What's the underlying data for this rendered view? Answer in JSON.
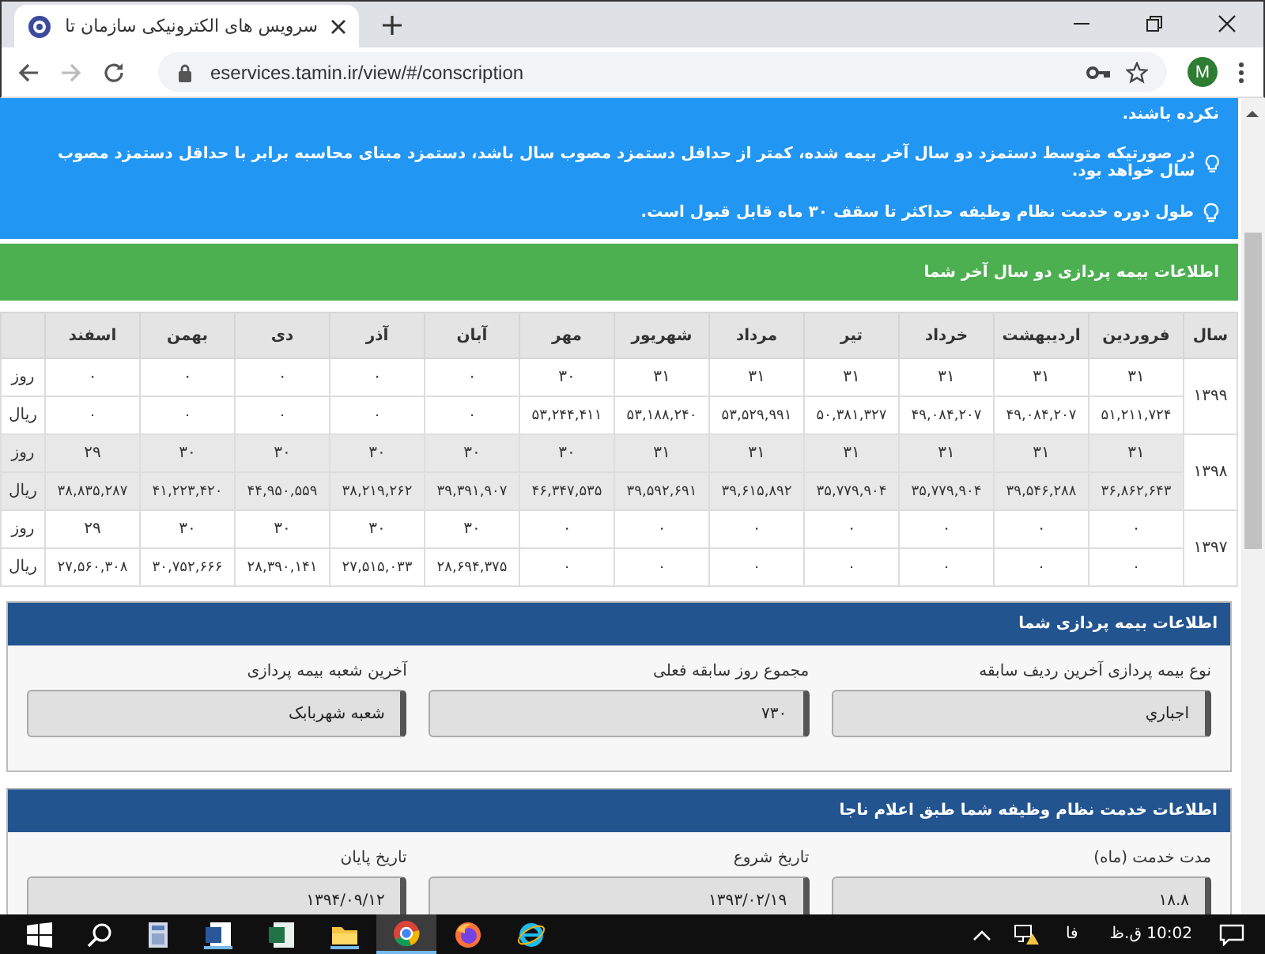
{
  "browser": {
    "tab_title": "سرویس های الکترونیکی سازمان تا",
    "url": "eservices.tamin.ir/view/#/conscription",
    "profile_initial": "M"
  },
  "notice": {
    "fragment": "نکرده باشند.",
    "tips": [
      "در صورتیکه متوسط دستمزد دو سال آخر بیمه شده، کمتر از حداقل دستمزد مصوب سال باشد، دستمزد مبنای محاسبه برابر با حداقل دستمزد مصوب سال خواهد بود.",
      "طول دوره خدمت نظام وظیفه حداکثر تا سقف ۳۰ ماه قابل قبول است."
    ]
  },
  "insurance_history": {
    "title": "اطلاعات بیمه پردازی دو سال آخر شما",
    "columns": [
      "سال",
      "فروردین",
      "اردیبهشت",
      "خرداد",
      "تیر",
      "مرداد",
      "شهریور",
      "مهر",
      "آبان",
      "آذر",
      "دی",
      "بهمن",
      "اسفند"
    ],
    "rows": [
      {
        "year": "۱۳۹۹",
        "days_unit": "روز",
        "rials_unit": "ریال",
        "days": [
          "۳۱",
          "۳۱",
          "۳۱",
          "۳۱",
          "۳۱",
          "۳۱",
          "۳۰",
          "۰",
          "۰",
          "۰",
          "۰",
          "۰"
        ],
        "rials": [
          "۵۱,۲۱۱,۷۲۴",
          "۴۹,۰۸۴,۲۰۷",
          "۴۹,۰۸۴,۲۰۷",
          "۵۰,۳۸۱,۳۲۷",
          "۵۳,۵۲۹,۹۹۱",
          "۵۳,۱۸۸,۲۴۰",
          "۵۳,۲۴۴,۴۱۱",
          "۰",
          "۰",
          "۰",
          "۰",
          "۰"
        ]
      },
      {
        "year": "۱۳۹۸",
        "days_unit": "روز",
        "rials_unit": "ریال",
        "days": [
          "۳۱",
          "۳۱",
          "۳۱",
          "۳۱",
          "۳۱",
          "۳۱",
          "۳۰",
          "۳۰",
          "۳۰",
          "۳۰",
          "۳۰",
          "۲۹"
        ],
        "rials": [
          "۳۶,۸۶۲,۶۴۳",
          "۳۹,۵۴۶,۲۸۸",
          "۳۵,۷۷۹,۹۰۴",
          "۳۵,۷۷۹,۹۰۴",
          "۳۹,۶۱۵,۸۹۲",
          "۳۹,۵۹۲,۶۹۱",
          "۴۶,۳۴۷,۵۳۵",
          "۳۹,۳۹۱,۹۰۷",
          "۳۸,۲۱۹,۲۶۲",
          "۴۴,۹۵۰,۵۵۹",
          "۴۱,۲۲۳,۴۲۰",
          "۳۸,۸۳۵,۲۸۷"
        ]
      },
      {
        "year": "۱۳۹۷",
        "days_unit": "روز",
        "rials_unit": "ریال",
        "days": [
          "۰",
          "۰",
          "۰",
          "۰",
          "۰",
          "۰",
          "۰",
          "۳۰",
          "۳۰",
          "۳۰",
          "۳۰",
          "۲۹"
        ],
        "rials": [
          "۰",
          "۰",
          "۰",
          "۰",
          "۰",
          "۰",
          "۰",
          "۲۸,۶۹۴,۳۷۵",
          "۲۷,۵۱۵,۰۳۳",
          "۲۸,۳۹۰,۱۴۱",
          "۳۰,۷۵۲,۶۶۶",
          "۲۷,۵۶۰,۳۰۸"
        ]
      }
    ]
  },
  "panels": [
    {
      "title": "اطلاعات بیمه پردازی شما",
      "fields": [
        {
          "label": "نوع بیمه پردازی آخرین ردیف سابقه",
          "value": "اجباري"
        },
        {
          "label": "مجموع روز سابقه فعلی",
          "value": "۷۳۰"
        },
        {
          "label": "آخرین شعبه بیمه پردازی",
          "value": "شعبه شهربابک"
        }
      ]
    },
    {
      "title": "اطلاعات خدمت نظام وظیفه شما طبق اعلام ناجا",
      "fields": [
        {
          "label": "مدت خدمت (ماه)",
          "value": "۱۸.۸"
        },
        {
          "label": "تاریخ شروع",
          "value": "۱۳۹۳/۰۲/۱۹"
        },
        {
          "label": "تاریخ پایان",
          "value": "۱۳۹۴/۰۹/۱۲"
        }
      ]
    }
  ],
  "taskbar": {
    "language": "فا",
    "clock": "10:02 ق.ظ"
  }
}
